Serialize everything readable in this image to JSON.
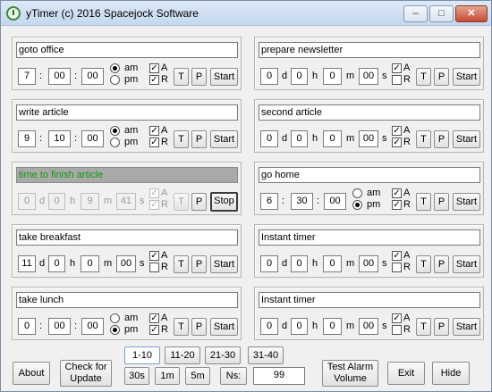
{
  "window": {
    "title": "yTimer (c) 2016 Spacejock Software",
    "minimize": "–",
    "maximize": "□",
    "close": "✕"
  },
  "labels": {
    "colon": ":",
    "d": "d",
    "h": "h",
    "m": "m",
    "s": "s",
    "am": "am",
    "pm": "pm",
    "A": "A",
    "R": "R",
    "T": "T",
    "P": "P",
    "start": "Start",
    "stop": "Stop",
    "check": "✓"
  },
  "timers": [
    {
      "name": "goto office",
      "mode": "clock",
      "hh": "7",
      "mm": "00",
      "ss": "00",
      "ampm": "am",
      "alarm": true,
      "repeat": true
    },
    {
      "name": "prepare newsletter",
      "mode": "countdown",
      "d": "0",
      "h": "0",
      "m": "0",
      "s": "00",
      "alarm": true,
      "repeat": false
    },
    {
      "name": "write article",
      "mode": "clock",
      "hh": "9",
      "mm": "10",
      "ss": "00",
      "ampm": "am",
      "alarm": true,
      "repeat": true
    },
    {
      "name": "second article",
      "mode": "countdown",
      "d": "0",
      "h": "0",
      "m": "0",
      "s": "00",
      "alarm": true,
      "repeat": true
    },
    {
      "name": "time to finish article",
      "mode": "countdown",
      "running": true,
      "d": "0",
      "h": "0",
      "m": "9",
      "s": "41",
      "alarm": true,
      "repeat": true
    },
    {
      "name": "go home",
      "mode": "clock",
      "hh": "6",
      "mm": "30",
      "ss": "00",
      "ampm": "pm",
      "alarm": true,
      "repeat": true
    },
    {
      "name": "take breakfast",
      "mode": "countdown",
      "d": "11",
      "h": "0",
      "m": "0",
      "s": "00",
      "alarm": true,
      "repeat": false
    },
    {
      "name": "Instant timer",
      "mode": "countdown",
      "d": "0",
      "h": "0",
      "m": "0",
      "s": "00",
      "alarm": true,
      "repeat": false
    },
    {
      "name": "take lunch",
      "mode": "clock",
      "hh": "0",
      "mm": "00",
      "ss": "00",
      "ampm": "pm",
      "alarm": true,
      "repeat": true
    },
    {
      "name": "Instant timer",
      "mode": "countdown",
      "d": "0",
      "h": "0",
      "m": "0",
      "s": "00",
      "alarm": true,
      "repeat": false
    }
  ],
  "pages": {
    "items": [
      "1-10",
      "11-20",
      "21-30",
      "31-40"
    ],
    "selected": "1-10"
  },
  "quick": {
    "items": [
      "30s",
      "1m",
      "5m"
    ],
    "ns_label": "Ns:",
    "ns_value": "99"
  },
  "footer": {
    "about": "About",
    "check_update": "Check for Update",
    "test_alarm": "Test Alarm Volume",
    "exit": "Exit",
    "hide": "Hide"
  }
}
